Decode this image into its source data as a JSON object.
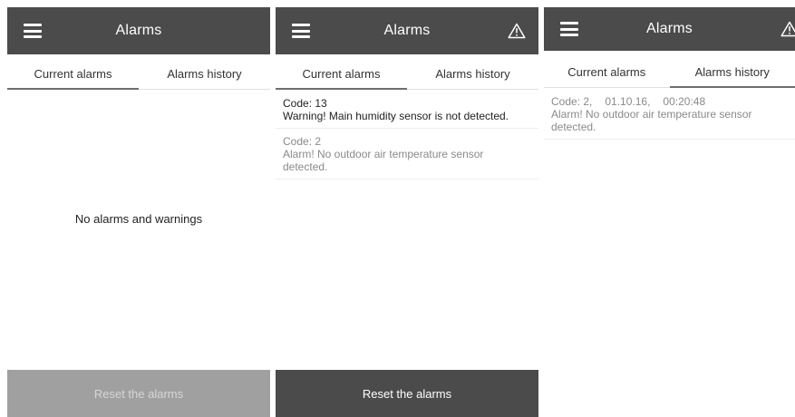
{
  "colors": {
    "appbar": "#4b4b4b",
    "reset_disabled": "#a0a0a0",
    "reset_enabled": "#4b4b4b",
    "tab_indicator": "#6e6e6e"
  },
  "icons": {
    "menu": "hamburger-menu-icon",
    "warning": "warning-triangle-icon"
  },
  "screen1": {
    "title": "Alarms",
    "tabs": [
      "Current alarms",
      "Alarms history"
    ],
    "active_tab": "Current alarms",
    "empty_message": "No alarms and warnings",
    "reset_label": "Reset the alarms",
    "reset_enabled": false
  },
  "screen2": {
    "title": "Alarms",
    "tabs": [
      "Current alarms",
      "Alarms history"
    ],
    "active_tab": "Current alarms",
    "alarms": [
      {
        "code": "Code: 13",
        "message": "Warning! Main humidity sensor is not detected."
      },
      {
        "code": "Code: 2",
        "message": "Alarm! No outdoor air temperature sensor detected."
      }
    ],
    "reset_label": "Reset the alarms",
    "reset_enabled": true
  },
  "screen3": {
    "title": "Alarms",
    "tabs": [
      "Current alarms",
      "Alarms history"
    ],
    "active_tab": "Alarms history",
    "history": [
      {
        "code": "Code: 2,",
        "date": "01.10.16,",
        "time": "00:20:48",
        "message": "Alarm! No outdoor air temperature sensor detected."
      }
    ]
  }
}
